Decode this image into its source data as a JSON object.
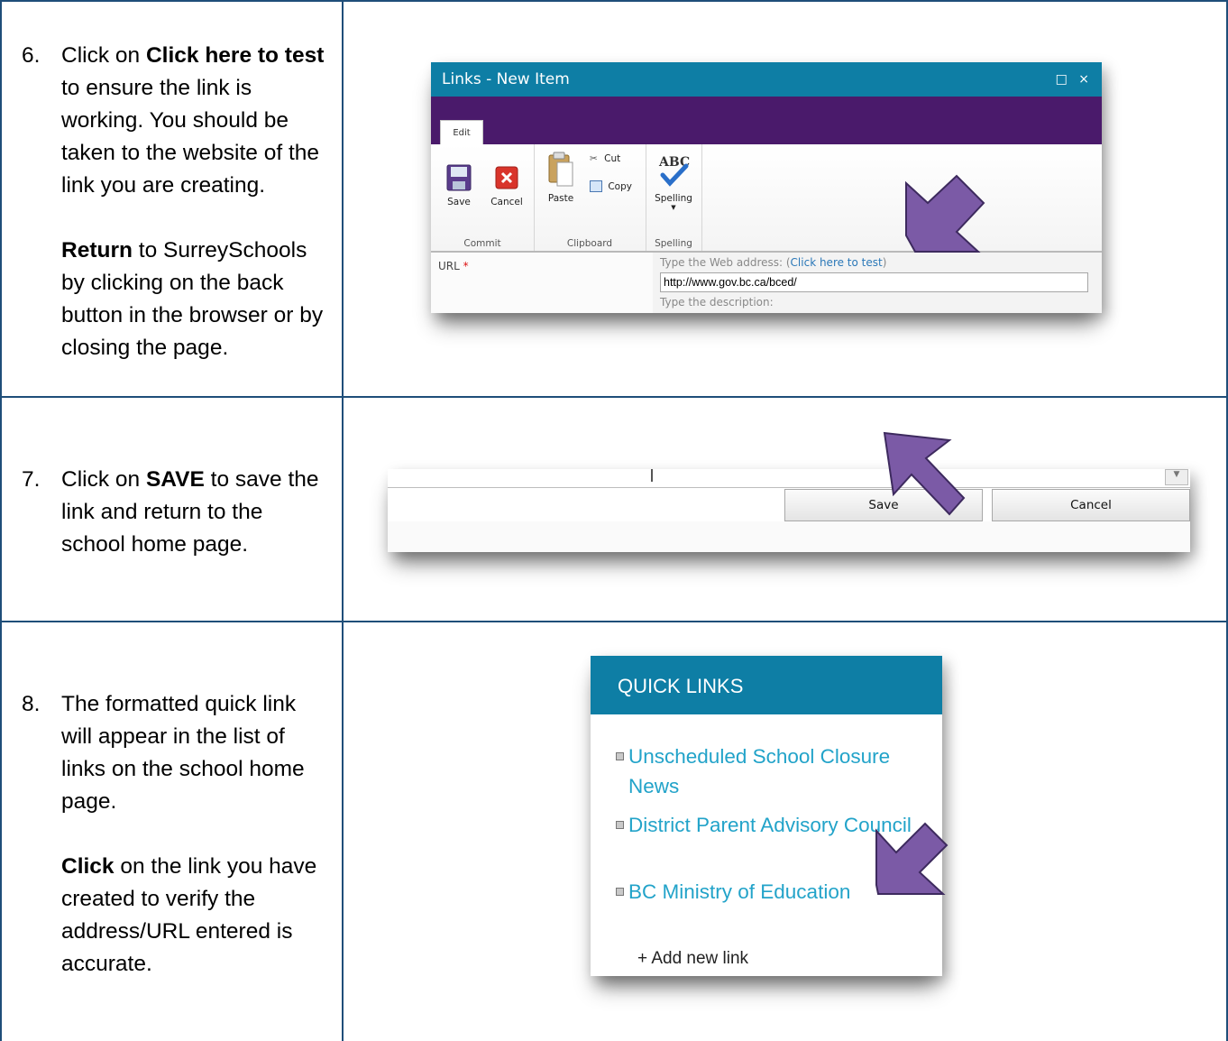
{
  "steps": [
    {
      "number": "6.",
      "p1_pre": "Click on ",
      "p1_bold": "Click here to test",
      "p1_post": " to ensure the link is working. You should be taken to the website of the link you are creating.",
      "p2_bold": "Return",
      "p2_post": " to SurreySchools by clicking on the back button in the browser or by closing the page."
    },
    {
      "number": "7.",
      "p1_pre": "Click on ",
      "p1_bold": "SAVE",
      "p1_post": " to save the link and return to the school home page."
    },
    {
      "number": "8.",
      "p1": "The formatted quick link will appear in the list of links on the school home page.",
      "p2_bold": "Click",
      "p2_post": " on the link you have created to verify the address/URL entered is accurate."
    }
  ],
  "dialog": {
    "title": "Links - New Item",
    "window_buttons": "□ ×",
    "tab": "Edit",
    "buttons": {
      "save": "Save",
      "cancel": "Cancel",
      "paste": "Paste",
      "cut": "Cut",
      "copy": "Copy",
      "spelling": "Spelling"
    },
    "groups": {
      "commit": "Commit",
      "clipboard": "Clipboard",
      "spelling": "Spelling"
    },
    "url_label": "URL",
    "required_mark": " *",
    "hint_pre": "Type the Web address: (",
    "hint_link": "Click here to test",
    "hint_post": ")",
    "url_value": "http://www.gov.bc.ca/bced/",
    "desc_hint": "Type the description:"
  },
  "savebar": {
    "save": "Save",
    "cancel": "Cancel"
  },
  "quick_links": {
    "title": "QUICK LINKS",
    "items": [
      "Unscheduled School Closure News",
      "District Parent Advisory Council",
      "BC Ministry of Education"
    ],
    "add_link": "+ Add new link"
  },
  "colors": {
    "dialog_title_bg": "#0e7ea5",
    "ribbon_bar": "#4a1a6b",
    "arrow_fill": "#7b5aa6",
    "link_color": "#22a3c9",
    "grid_line": "#1f4e79"
  }
}
